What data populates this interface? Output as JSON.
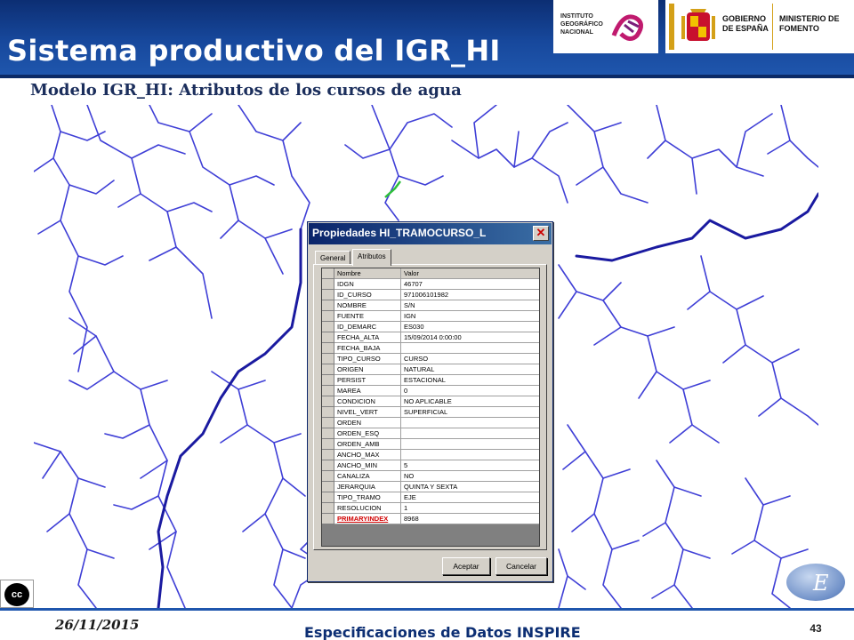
{
  "slide": {
    "title": "Sistema productivo del IGR_HI",
    "subtitle": "Modelo IGR_HI: Atributos de los cursos de agua"
  },
  "logos": {
    "ign_text": "INSTITUTO GEOGRÁFICO NACIONAL",
    "gobierno": "GOBIERNO DE ESPAÑA",
    "ministerio": "MINISTERIO DE FOMENTO"
  },
  "dialog": {
    "title": "Propiedades HI_TRAMOCURSO_L",
    "close_glyph": "✕",
    "tabs": [
      {
        "label": "General",
        "active": false
      },
      {
        "label": "Atributos",
        "active": true
      }
    ],
    "columns": {
      "name": "Nombre",
      "value": "Valor"
    },
    "rows": [
      {
        "name": "IDGN",
        "value": "46707"
      },
      {
        "name": "ID_CURSO",
        "value": "971006101982"
      },
      {
        "name": "NOMBRE",
        "value": "S/N"
      },
      {
        "name": "FUENTE",
        "value": "IGN"
      },
      {
        "name": "ID_DEMARC",
        "value": "ES030"
      },
      {
        "name": "FECHA_ALTA",
        "value": "15/09/2014 0:00:00"
      },
      {
        "name": "FECHA_BAJA",
        "value": ""
      },
      {
        "name": "TIPO_CURSO",
        "value": "CURSO"
      },
      {
        "name": "ORIGEN",
        "value": "NATURAL"
      },
      {
        "name": "PERSIST",
        "value": "ESTACIONAL"
      },
      {
        "name": "MAREA",
        "value": "0"
      },
      {
        "name": "CONDICION",
        "value": "NO APLICABLE"
      },
      {
        "name": "NIVEL_VERT",
        "value": "SUPERFICIAL"
      },
      {
        "name": "ORDEN",
        "value": ""
      },
      {
        "name": "ORDEN_ESQ",
        "value": ""
      },
      {
        "name": "ORDEN_AMB",
        "value": ""
      },
      {
        "name": "ANCHO_MAX",
        "value": ""
      },
      {
        "name": "ANCHO_MIN",
        "value": "5"
      },
      {
        "name": "CANALIZA",
        "value": "NO"
      },
      {
        "name": "JERARQUIA",
        "value": "QUINTA Y SEXTA"
      },
      {
        "name": "TIPO_TRAMO",
        "value": "EJE"
      },
      {
        "name": "RESOLUCION",
        "value": "1"
      },
      {
        "name": "PRIMARYINDEX",
        "value": "8968",
        "primary": true
      }
    ],
    "buttons": {
      "ok": "Aceptar",
      "cancel": "Cancelar"
    }
  },
  "footer": {
    "date": "26/11/2015",
    "title": "Especificaciones de Datos INSPIRE",
    "page": "43"
  },
  "badges": {
    "cc": "cc",
    "inspire_letter": "E"
  },
  "colors": {
    "header_blue": "#17489c",
    "river_line": "#3f3fd6",
    "main_river": "#1a1aa0",
    "selected_segment": "#2dbf3a",
    "pk_red": "#d00000"
  }
}
